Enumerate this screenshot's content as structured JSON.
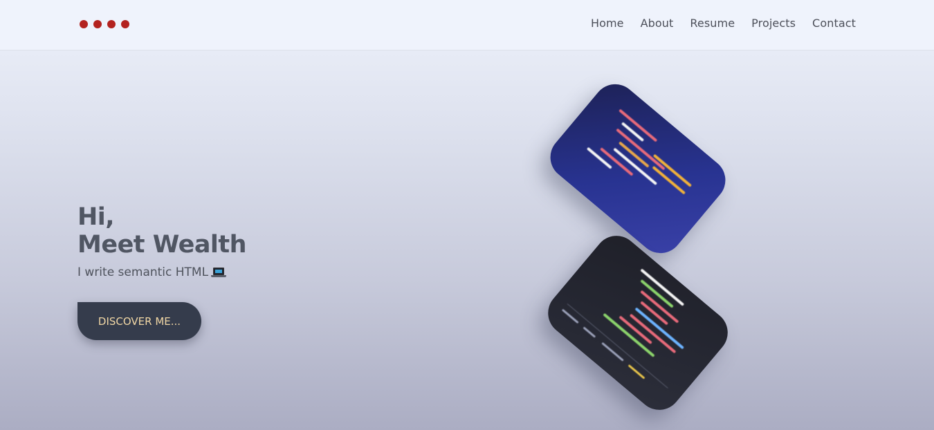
{
  "nav": {
    "logo_dots": 4,
    "links": [
      "Home",
      "About",
      "Resume",
      "Projects",
      "Contact"
    ]
  },
  "hero": {
    "greeting": "Hi,",
    "name_line": "Meet Wealth",
    "tagline": "I write semantic HTML",
    "tagline_icon": "laptop-icon",
    "cta_label": "DISCOVER ME..."
  },
  "colors": {
    "logo_dot": "#b3221f",
    "cta_bg": "#353c4c",
    "cta_text": "#f1d7a5"
  }
}
